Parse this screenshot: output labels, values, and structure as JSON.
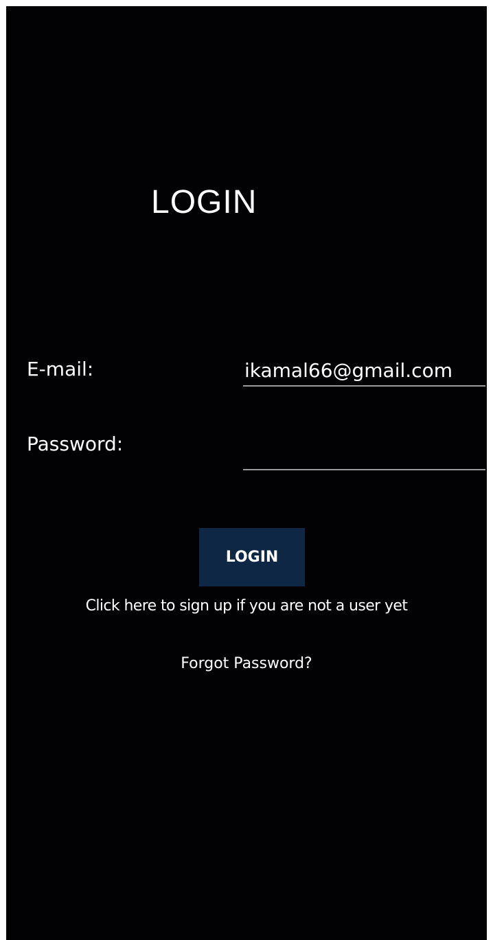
{
  "page": {
    "title": "LOGIN"
  },
  "form": {
    "email_label": "E-mail:",
    "email_value": "ikamal66@gmail.com",
    "password_label": "Password:",
    "password_value": ""
  },
  "actions": {
    "login_label": "LOGIN",
    "signup_link": "Click here to sign up if you are not a user yet",
    "forgot_link": "Forgot Password?"
  },
  "colors": {
    "background": "#020204",
    "button": "#0e2744",
    "underline": "#9a9a9a",
    "text": "#ffffff"
  }
}
